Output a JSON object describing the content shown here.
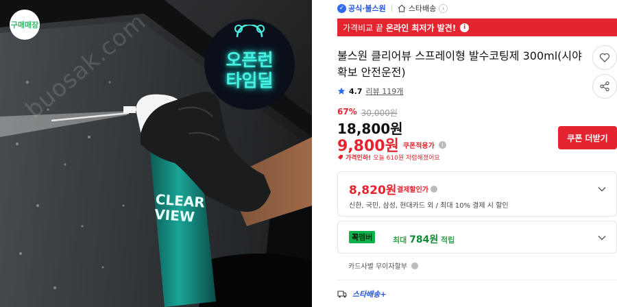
{
  "image": {
    "store_badge": "구매매장",
    "watermark": "buosak.com",
    "promo_line1": "오픈런",
    "promo_line2": "타임딜",
    "can_label": "CLEAR VIEW"
  },
  "meta": {
    "official_label": "공식·불스원",
    "shipping_label": "스타배송"
  },
  "banner": {
    "prefix": "가격비교 끝",
    "highlight": "온라인 최저가 발견!"
  },
  "product": {
    "title": "불스원 클리어뷰 스프레이형 발수코팅제 300ml(시야확보 안전운전)",
    "rating": "4.7",
    "reviews": "리뷰 119개"
  },
  "price": {
    "discount_pct": "67%",
    "original": "30,000원",
    "sale": "18,800원",
    "coupon": "9,800원",
    "coupon_label": "쿠폰적용가",
    "coupon_button": "쿠폰 더받기",
    "alert_prefix": "가격인하!",
    "alert_text": "오늘 610원 저렴해졌어요"
  },
  "card_discount": {
    "amount": "8,820원",
    "label": "결제할인가",
    "desc": "신한, 국민, 삼성, 현대카드 외 / 최대 10% 결제 시 할인"
  },
  "member": {
    "logo_a": "꼭",
    "logo_b": "멤버",
    "prefix": "최대",
    "amount": "784원",
    "suffix": "적립"
  },
  "installment": {
    "label": "카드사별 무이자할부"
  },
  "delivery": {
    "label": "스타배송+"
  },
  "colors": {
    "accent_red": "#e4242f",
    "official_blue": "#2257d4",
    "member_green": "#10b04a",
    "neon": "#48f3e4"
  }
}
